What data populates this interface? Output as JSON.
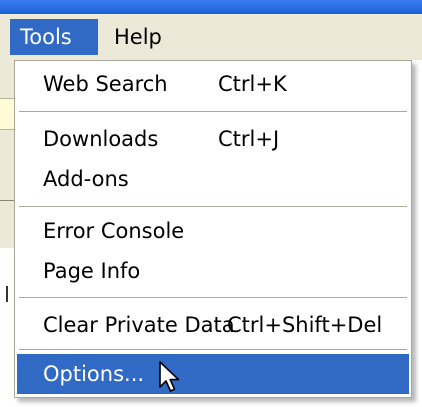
{
  "menubar": {
    "items": [
      {
        "label": "Tools"
      },
      {
        "label": "Help"
      }
    ]
  },
  "dropdown": {
    "items": [
      {
        "label": "Web Search",
        "shortcut": "Ctrl+K"
      },
      {
        "label": "Downloads",
        "shortcut": "Ctrl+J"
      },
      {
        "label": "Add-ons"
      },
      {
        "label": "Error Console"
      },
      {
        "label": "Page Info"
      },
      {
        "label": "Clear Private Data",
        "shortcut": "Ctrl+Shift+Del"
      },
      {
        "label": "Options...",
        "highlighted": true
      }
    ]
  },
  "colors": {
    "highlight": "#316ac5",
    "menubar": "#ece9d8",
    "title_strip": "#1b5fd8"
  },
  "icons": {
    "pointer": "mouse-pointer-icon"
  }
}
